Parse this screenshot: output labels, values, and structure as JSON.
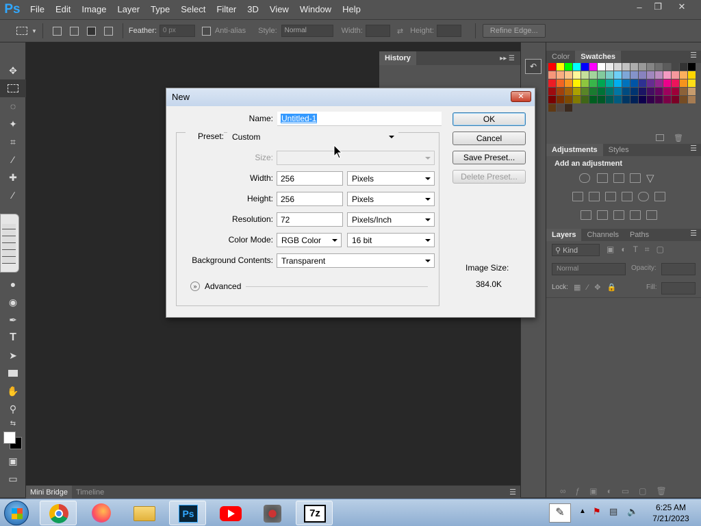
{
  "menubar": {
    "logo": "Ps",
    "items": [
      "File",
      "Edit",
      "Image",
      "Layer",
      "Type",
      "Select",
      "Filter",
      "3D",
      "View",
      "Window",
      "Help"
    ],
    "win_minimize": "–",
    "win_restore": "❐",
    "win_close": "✕"
  },
  "options": {
    "feather_label": "Feather:",
    "feather_value": "0 px",
    "antialias_label": "Anti-alias",
    "style_label": "Style:",
    "style_value": "Normal",
    "width_label": "Width:",
    "height_label": "Height:",
    "refine_label": "Refine Edge..."
  },
  "panels": {
    "history_tab": "History",
    "color_tab": "Color",
    "swatches_tab": "Swatches",
    "adjustments_tab": "Adjustments",
    "styles_tab": "Styles",
    "add_adjustment": "Add an adjustment",
    "layers_tab": "Layers",
    "channels_tab": "Channels",
    "paths_tab": "Paths",
    "kind_label": "Kind",
    "blend_mode": "Normal",
    "opacity_label": "Opacity:",
    "lock_label": "Lock:",
    "fill_label": "Fill:"
  },
  "bottom": {
    "tab_minibridge": "Mini Bridge",
    "tab_timeline": "Timeline"
  },
  "dialog": {
    "title": "New",
    "close": "✕",
    "name_label": "Name:",
    "name_value": "Untitled-1",
    "preset_label": "Preset:",
    "preset_value": "Custom",
    "size_label": "Size:",
    "width_label": "Width:",
    "width_value": "256",
    "width_unit": "Pixels",
    "height_label": "Height:",
    "height_value": "256",
    "height_unit": "Pixels",
    "resolution_label": "Resolution:",
    "resolution_value": "72",
    "resolution_unit": "Pixels/Inch",
    "colormode_label": "Color Mode:",
    "colormode_value": "RGB Color",
    "bitdepth_value": "16 bit",
    "background_label": "Background Contents:",
    "background_value": "Transparent",
    "advanced_label": "Advanced",
    "ok": "OK",
    "cancel": "Cancel",
    "save_preset": "Save Preset...",
    "delete_preset": "Delete Preset...",
    "image_size_label": "Image Size:",
    "image_size_value": "384.0K"
  },
  "taskbar": {
    "time": "6:25 AM",
    "date": "7/21/2023",
    "ps_label": "Ps",
    "sevenzip_label": "7z"
  },
  "swatch_colors": [
    "#ff0000",
    "#ffff00",
    "#00ff00",
    "#00ffff",
    "#0000ff",
    "#ff00ff",
    "#ffffff",
    "#ebebeb",
    "#d6d6d6",
    "#c2c2c2",
    "#adadad",
    "#999999",
    "#858585",
    "#707070",
    "#5c5c5c",
    "#474747",
    "#333333",
    "#000000",
    "#f7977a",
    "#f9ad81",
    "#fdc68a",
    "#fff79a",
    "#c4df9b",
    "#a3d39c",
    "#82ca9d",
    "#7bcdc8",
    "#6ecff6",
    "#7ea7d8",
    "#8493ca",
    "#8882be",
    "#a187be",
    "#bc8dbf",
    "#f49ac2",
    "#f6989d",
    "#fbaf5d",
    "#ffd600",
    "#ed1c24",
    "#f26522",
    "#f7941d",
    "#fff200",
    "#8dc63f",
    "#39b54a",
    "#00a651",
    "#00a99d",
    "#00aeef",
    "#0072bc",
    "#0054a6",
    "#2e3192",
    "#662d91",
    "#92278f",
    "#ec008c",
    "#ed145b",
    "#f7941d",
    "#ffde17",
    "#9e0b0f",
    "#a0410d",
    "#a36209",
    "#aba000",
    "#598527",
    "#1a7b30",
    "#007236",
    "#00746b",
    "#0076a3",
    "#004b80",
    "#003471",
    "#1b1464",
    "#440e62",
    "#630460",
    "#9e005d",
    "#9e0039",
    "#8c6239",
    "#c69c6d",
    "#790000",
    "#7b2e00",
    "#7d4900",
    "#827b00",
    "#406618",
    "#005e20",
    "#005826",
    "#005952",
    "#005b7f",
    "#003663",
    "#002157",
    "#0d004c",
    "#32004b",
    "#4b0049",
    "#7b0046",
    "#7a0026",
    "#754c24",
    "#a67c52",
    "#603913",
    "#534741",
    "#3c2a1e"
  ]
}
